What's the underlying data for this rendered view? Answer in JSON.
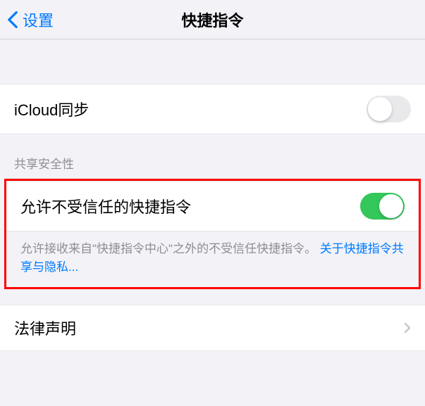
{
  "nav": {
    "back_label": "设置",
    "title": "快捷指令"
  },
  "cells": {
    "icloud_sync": "iCloud同步",
    "allow_untrusted": "允许不受信任的快捷指令",
    "legal": "法律声明"
  },
  "section_header": "共享安全性",
  "footer": {
    "text": "允许接收来自\"快捷指令中心\"之外的不受信任快捷指令。 ",
    "link": "关于快捷指令共享与隐私..."
  },
  "toggles": {
    "icloud_sync": false,
    "allow_untrusted": true
  }
}
